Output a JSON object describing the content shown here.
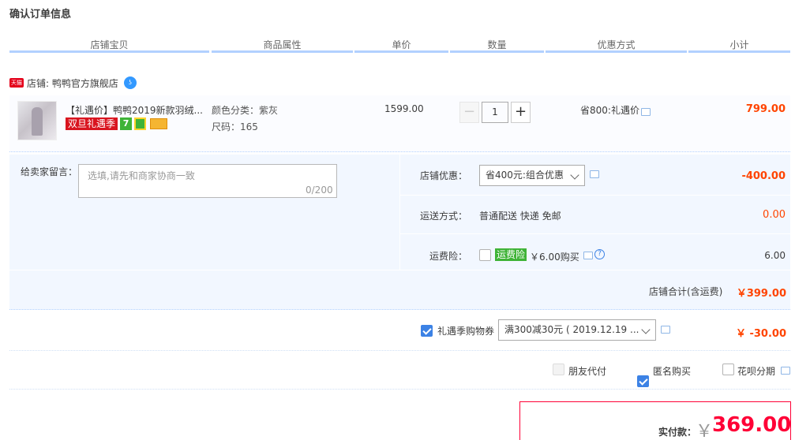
{
  "page_title": "确认订单信息",
  "columns": [
    "店铺宝贝",
    "商品属性",
    "单价",
    "数量",
    "优惠方式",
    "小计"
  ],
  "shop": {
    "badge": "天猫",
    "label": "店铺: 鸭鸭官方旗舰店"
  },
  "item": {
    "title": "【礼遇价】鸭鸭2019新款羽绒...",
    "promo_badge": "双旦礼遇季",
    "promo_icon_7": "7",
    "sku_color": "颜色分类：紫灰",
    "sku_size": "尺码：165",
    "unit_price": "1599.00",
    "quantity": "1",
    "minus": "−",
    "plus": "+",
    "discount": "省800:礼遇价",
    "subtotal": "799.00"
  },
  "note": {
    "label": "给卖家留言：",
    "placeholder": "选填,请先和商家协商一致",
    "counter": "0/200"
  },
  "shop_discount": {
    "label": "店铺优惠：",
    "selected": "省400元:组合优惠",
    "amount": "-400.00"
  },
  "shipping": {
    "label": "运送方式：",
    "value": "普通配送 快递 免邮",
    "amount": "0.00"
  },
  "insurance": {
    "label": "运费险：",
    "tag": "运费险",
    "price_text": "￥6.00购买",
    "amount": "6.00"
  },
  "shop_total": {
    "label": "店铺合计(含运费)",
    "amount": "￥399.00"
  },
  "coupon": {
    "label": "礼遇季购物券",
    "selected": "满300减30元 ( 2019.12.19 ...",
    "amount": "￥ -30.00",
    "checked": true
  },
  "options": {
    "friend_pay": "朋友代付",
    "anonymous": "匿名购买",
    "huabei": "花呗分期"
  },
  "payment": {
    "label": "实付款：",
    "currency": "￥",
    "amount": "369.00"
  },
  "colors": {
    "accent_blue": "#b2d1ff",
    "price_red": "#ff0036",
    "subtotal_orange": "#f40",
    "panel_bg": "#f2f7ff",
    "checkbox_blue": "#3c82e5"
  }
}
